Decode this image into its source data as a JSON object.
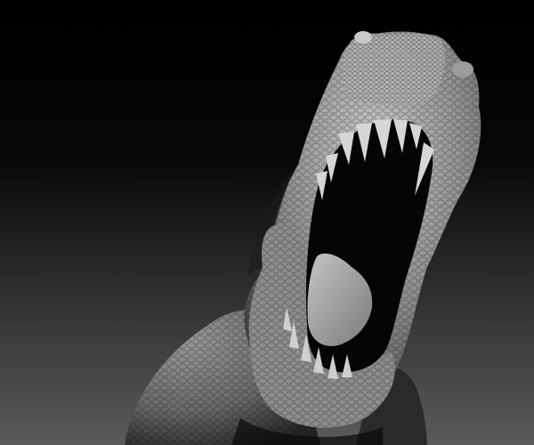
{
  "scene": {
    "subject": "dinosaur-head",
    "palette": {
      "background_top": "#000000",
      "background_bottom": "#5a5a5a",
      "skin_light": "#bdbdbd",
      "skin_mid": "#8a8a8a",
      "skin_dark": "#3a3a3a",
      "mouth_interior": "#050505",
      "tongue": "#a8a8a8",
      "teeth": "#d8d8d8"
    }
  }
}
